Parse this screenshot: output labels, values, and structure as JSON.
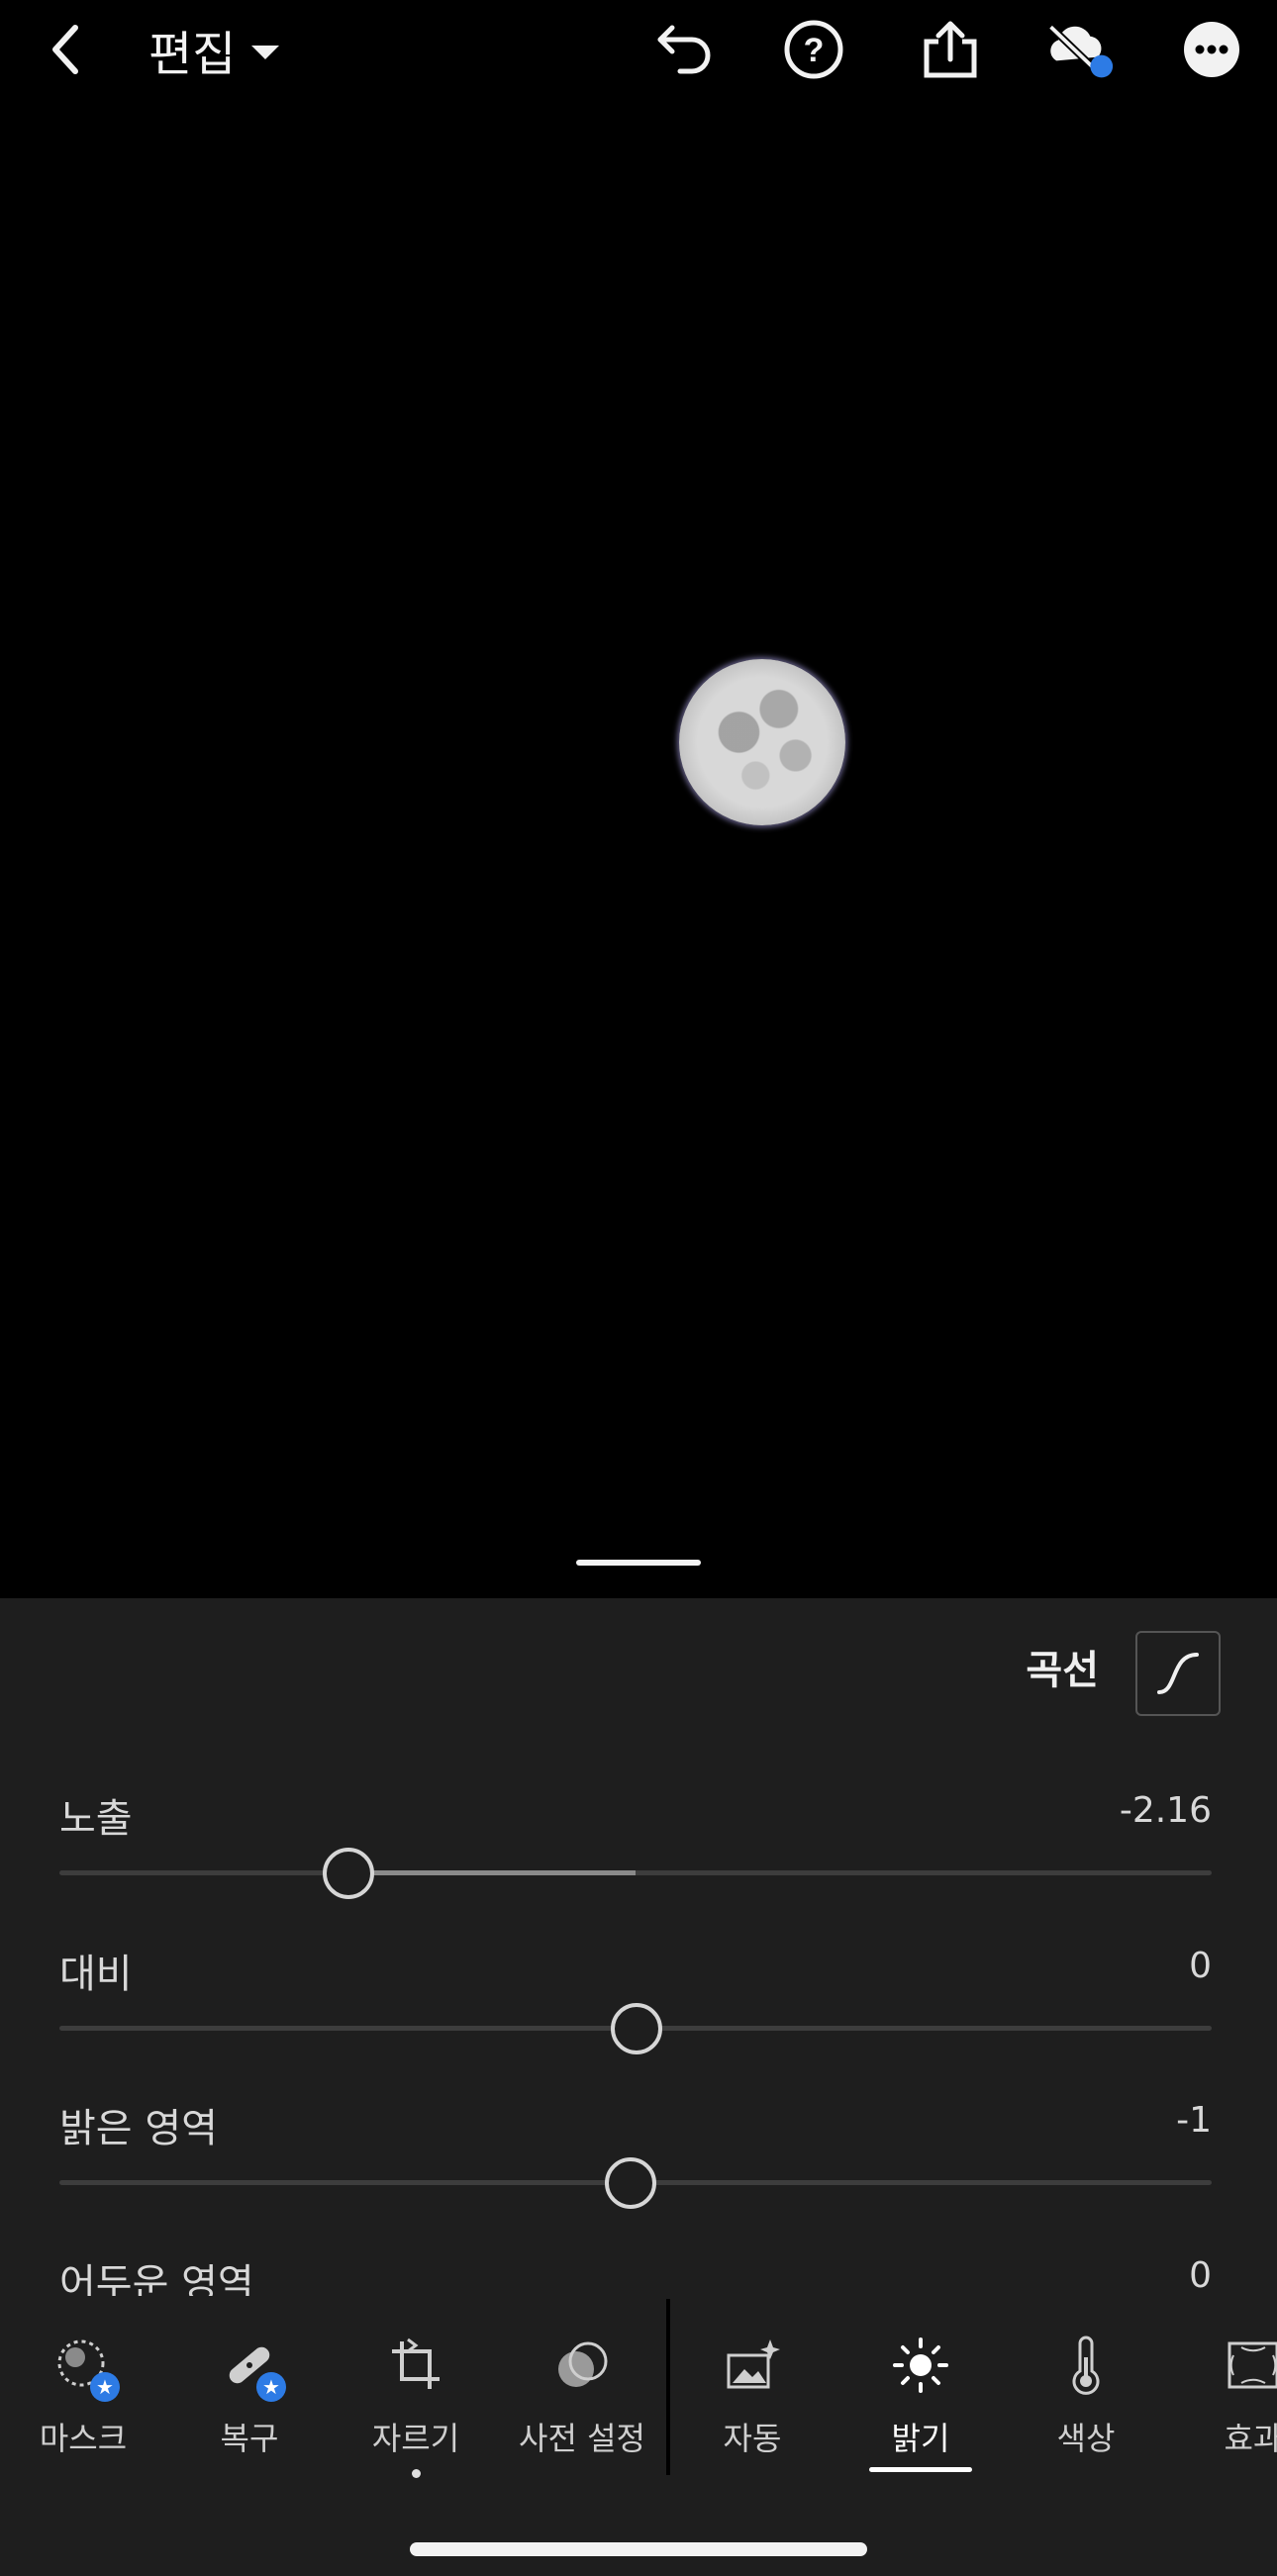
{
  "header": {
    "title": "편집",
    "icons": [
      "back-icon",
      "chevron-down-icon",
      "undo-icon",
      "help-icon",
      "share-icon",
      "cloud-sync-off-icon",
      "more-icon"
    ],
    "sync_badge_color": "#2d7be5"
  },
  "panel": {
    "curve_label": "곡선",
    "sliders": [
      {
        "label": "노출",
        "value": "-2.16",
        "position_pct": 25
      },
      {
        "label": "대비",
        "value": "0",
        "position_pct": 50
      },
      {
        "label": "밝은 영역",
        "value": "-1",
        "position_pct": 49.5
      },
      {
        "label": "어두운 영역",
        "value": "0"
      }
    ]
  },
  "toolbar": {
    "items": [
      {
        "label": "마스크",
        "icon": "mask-icon"
      },
      {
        "label": "복구",
        "icon": "healing-icon"
      },
      {
        "label": "자르기",
        "icon": "crop-icon"
      },
      {
        "label": "사전 설정",
        "icon": "presets-icon"
      },
      {
        "label": "자동",
        "icon": "auto-icon"
      },
      {
        "label": "밝기",
        "icon": "light-icon",
        "active": true
      },
      {
        "label": "색상",
        "icon": "thermometer-icon"
      },
      {
        "label": "효과",
        "icon": "effects-icon"
      }
    ]
  },
  "colors": {
    "panel_bg": "#1e1e1e",
    "accent": "#2d7be5"
  }
}
